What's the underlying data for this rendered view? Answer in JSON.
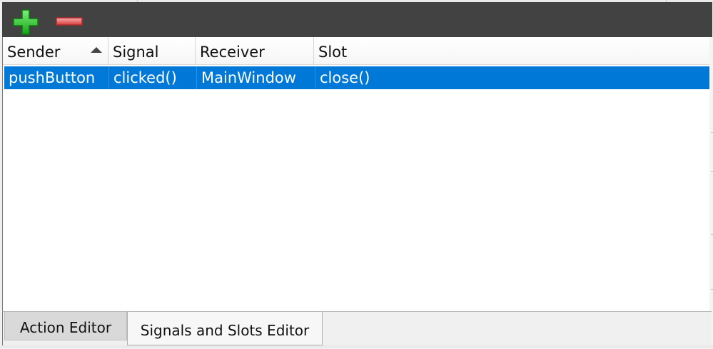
{
  "toolbar": {
    "add_icon": "plus-icon",
    "remove_icon": "minus-icon",
    "colors": {
      "background": "#424242",
      "add": "#22c322",
      "remove": "#e05050"
    }
  },
  "table": {
    "columns": [
      "Sender",
      "Signal",
      "Receiver",
      "Slot"
    ],
    "sorted_column": "Sender",
    "sort_order": "ascending",
    "rows": [
      {
        "sender": "pushButton",
        "signal": "clicked()",
        "receiver": "MainWindow",
        "slot": "close()"
      }
    ],
    "selected_row": 0,
    "selection_color": "#0078d7"
  },
  "tabs": [
    {
      "label": "Action Editor",
      "active": false
    },
    {
      "label": "Signals and Slots Editor",
      "active": true
    }
  ]
}
